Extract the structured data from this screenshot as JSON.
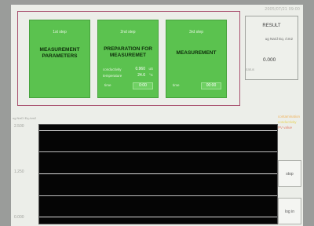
{
  "header": {
    "datetime": "2005/07/21 09:00"
  },
  "steps": [
    {
      "step_no": "1st step",
      "title_line1": "MEASUREMENT",
      "title_line2": "PARAMETERS"
    },
    {
      "step_no": "2nd step",
      "title_line1": "PREPARATION FOR",
      "title_line2": "MEASUREMET",
      "conductivity_label": "conductivity",
      "conductivity_value": "0.960",
      "conductivity_unit": "uS",
      "temperature_label": "temperature",
      "temperature_value": "24.6",
      "temperature_unit": "°C",
      "time_label": "time",
      "time_value": "0:00"
    },
    {
      "step_no": "3rd step",
      "title_line1": "MEASUREMENT",
      "time_label": "time",
      "time_value": "00:00"
    }
  ],
  "result": {
    "title": "RESULT",
    "unit": "ug NaCl Eq. /cm2",
    "value": "0.000"
  },
  "status": {
    "label": "status"
  },
  "chart": {
    "y_title": "ug NaCl Eq./cm2",
    "y_top": "2.500",
    "y_mid": "1.250",
    "y_bottom": "0.000"
  },
  "legend": {
    "line1": "contamination",
    "line2": "conductivity",
    "line3": "PV value"
  },
  "buttons": {
    "stop": "stop",
    "log_in": "log in"
  },
  "colors": {
    "step_green": "#5bc24f",
    "frame_magenta": "#a8506e",
    "chart_bg": "#050505",
    "legend_orange": "#f0b25a",
    "legend_yellow": "#e6d25a",
    "legend_red": "#e4806a"
  }
}
